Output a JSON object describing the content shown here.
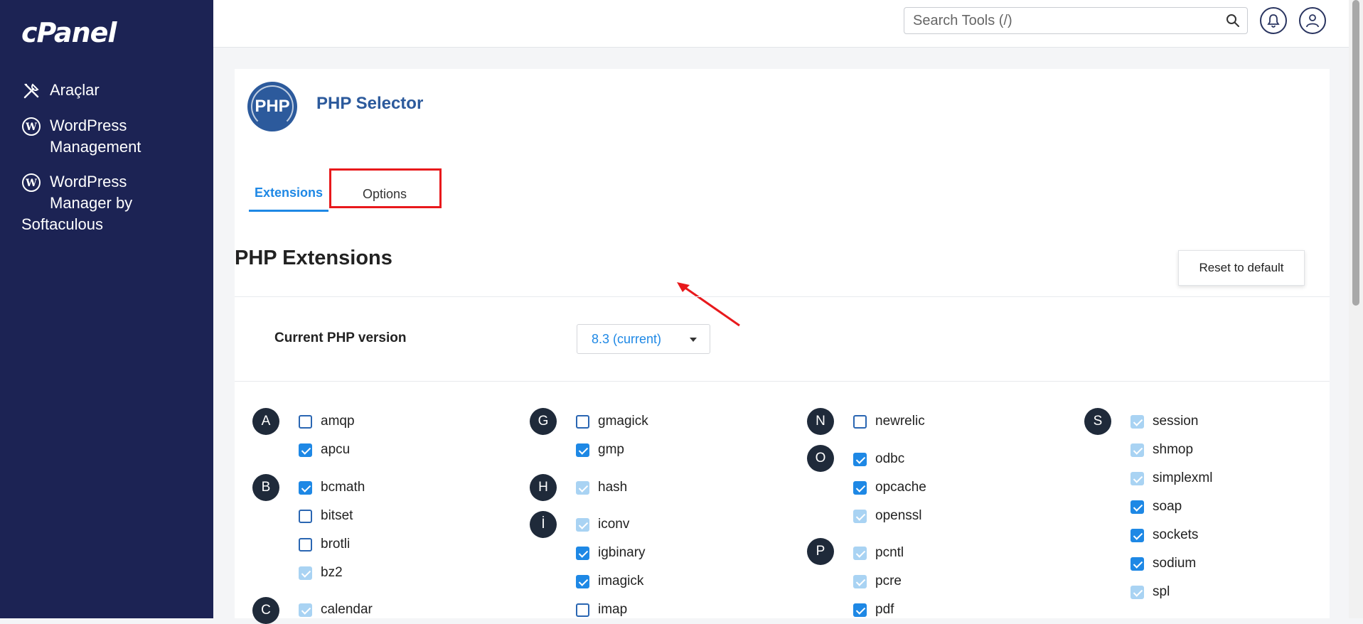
{
  "brand": "cPanel",
  "sidebar": {
    "items": [
      {
        "label": "Araçlar",
        "icon": "tools-icon"
      },
      {
        "label": "WordPress\nManagement",
        "icon": "wordpress-icon"
      },
      {
        "label": "WordPress\nManager by",
        "extra": "Softaculous",
        "icon": "wordpress-icon"
      }
    ]
  },
  "topbar": {
    "search_placeholder": "Search Tools (/)"
  },
  "page": {
    "logo_text": "PHP",
    "title": "PHP Selector",
    "tabs": [
      {
        "label": "Extensions",
        "active": true
      },
      {
        "label": "Options",
        "active": false
      }
    ],
    "section_title": "PHP Extensions",
    "reset_label": "Reset to default",
    "version_label": "Current PHP version",
    "version_value": "8.3 (current)"
  },
  "colors": {
    "sidebar": "#1c2354",
    "accent": "#1e88e5",
    "highlight": "#e8191c",
    "title": "#2c5a9c"
  },
  "extensions": {
    "letters": [
      "A",
      "B",
      "C",
      "G",
      "H",
      "İ",
      "N",
      "O",
      "P",
      "S"
    ],
    "items": [
      {
        "name": "amqp",
        "state": "unchecked"
      },
      {
        "name": "apcu",
        "state": "checked"
      },
      {
        "name": "bcmath",
        "state": "checked"
      },
      {
        "name": "bitset",
        "state": "unchecked"
      },
      {
        "name": "brotli",
        "state": "unchecked"
      },
      {
        "name": "bz2",
        "state": "disabled-checked"
      },
      {
        "name": "calendar",
        "state": "disabled-checked"
      },
      {
        "name": "gmagick",
        "state": "unchecked"
      },
      {
        "name": "gmp",
        "state": "checked"
      },
      {
        "name": "hash",
        "state": "disabled-checked"
      },
      {
        "name": "iconv",
        "state": "disabled-checked"
      },
      {
        "name": "igbinary",
        "state": "checked"
      },
      {
        "name": "imagick",
        "state": "checked"
      },
      {
        "name": "imap",
        "state": "unchecked"
      },
      {
        "name": "newrelic",
        "state": "unchecked"
      },
      {
        "name": "odbc",
        "state": "checked"
      },
      {
        "name": "opcache",
        "state": "checked"
      },
      {
        "name": "openssl",
        "state": "disabled-checked"
      },
      {
        "name": "pcntl",
        "state": "disabled-checked"
      },
      {
        "name": "pcre",
        "state": "disabled-checked"
      },
      {
        "name": "pdf",
        "state": "checked"
      },
      {
        "name": "session",
        "state": "disabled-checked"
      },
      {
        "name": "shmop",
        "state": "disabled-checked"
      },
      {
        "name": "simplexml",
        "state": "disabled-checked"
      },
      {
        "name": "soap",
        "state": "checked"
      },
      {
        "name": "sockets",
        "state": "checked"
      },
      {
        "name": "sodium",
        "state": "checked"
      },
      {
        "name": "spl",
        "state": "disabled-checked"
      }
    ]
  }
}
